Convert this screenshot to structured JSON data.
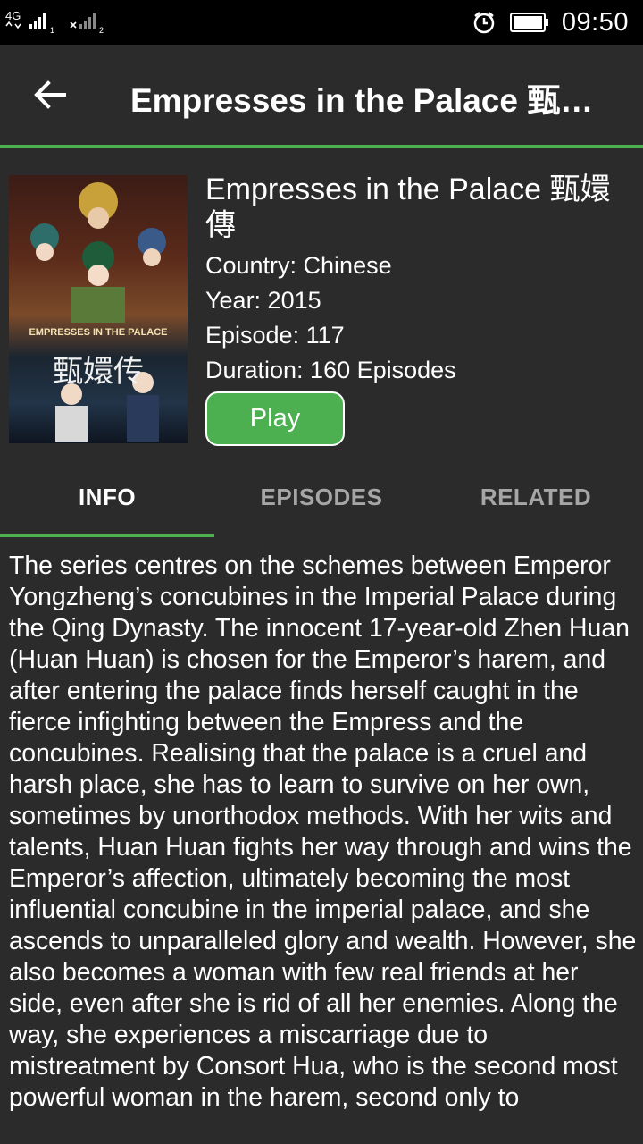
{
  "status_bar": {
    "network_label": "4G",
    "sim1_label": "1",
    "sim2_label": "2",
    "time": "09:50"
  },
  "app_bar": {
    "title": "Empresses in the Palace 甄嬛傳"
  },
  "poster": {
    "english_text": "EMPRESSES IN THE PALACE",
    "chinese_text": "甄嬛传"
  },
  "show": {
    "title": "Empresses in the Palace 甄嬛傳",
    "country": "Country: Chinese",
    "year": "Year: 2015",
    "episode": "Episode: 117",
    "duration": "Duration: 160 Episodes",
    "play_label": "Play"
  },
  "tabs": [
    {
      "label": "INFO"
    },
    {
      "label": "EPISODES"
    },
    {
      "label": "RELATED"
    }
  ],
  "description": "The series centres on the schemes between Emperor Yongzheng’s concubines in the Imperial Palace during the Qing Dynasty. The innocent 17-year-old Zhen Huan (Huan Huan) is chosen for the Emperor’s harem, and after entering the palace finds herself caught in the fierce infighting between the Empress and the concubines. Realising that the palace is a cruel and harsh place, she has to learn to survive on her own, sometimes by unorthodox methods. With her wits and talents, Huan Huan fights her way through and wins the Emperor’s affection, ultimately becoming the most influential concubine in the imperial palace, and she ascends to unparalleled glory and wealth. However, she also becomes a woman with few real friends at her side, even after she is rid of all her enemies. Along the way, she experiences a miscarriage due to mistreatment by Consort Hua, who is the second most powerful woman in the harem, second only to",
  "colors": {
    "accent": "#4caf50",
    "background": "#2b2b2b",
    "status_bar": "#000000",
    "inactive_tab": "#a6a6a6"
  }
}
